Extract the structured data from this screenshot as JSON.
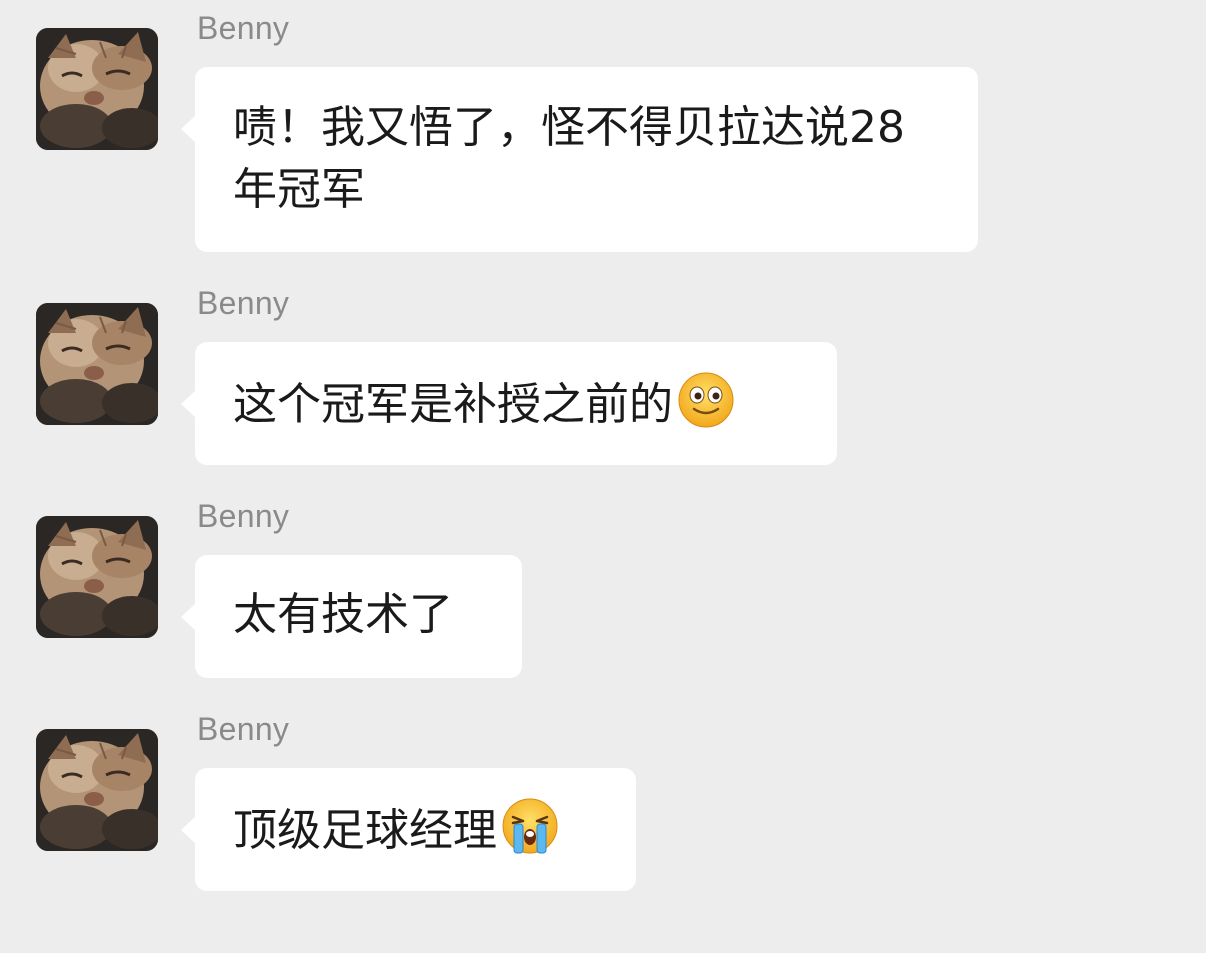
{
  "messages": [
    {
      "sender": "Benny",
      "text": "啧！我又悟了，怪不得贝拉达说28年冠军",
      "emoji": null
    },
    {
      "sender": "Benny",
      "text": "这个冠军是补授之前的",
      "emoji": "smile-emoji"
    },
    {
      "sender": "Benny",
      "text": "太有技术了",
      "emoji": null
    },
    {
      "sender": "Benny",
      "text": "顶级足球经理",
      "emoji": "crying-emoji"
    }
  ],
  "colors": {
    "background": "#ededed",
    "bubble": "#ffffff",
    "sender_name": "#8a8a8a",
    "text": "#1a1a1a"
  },
  "avatar": {
    "icon": "cat-avatar"
  }
}
